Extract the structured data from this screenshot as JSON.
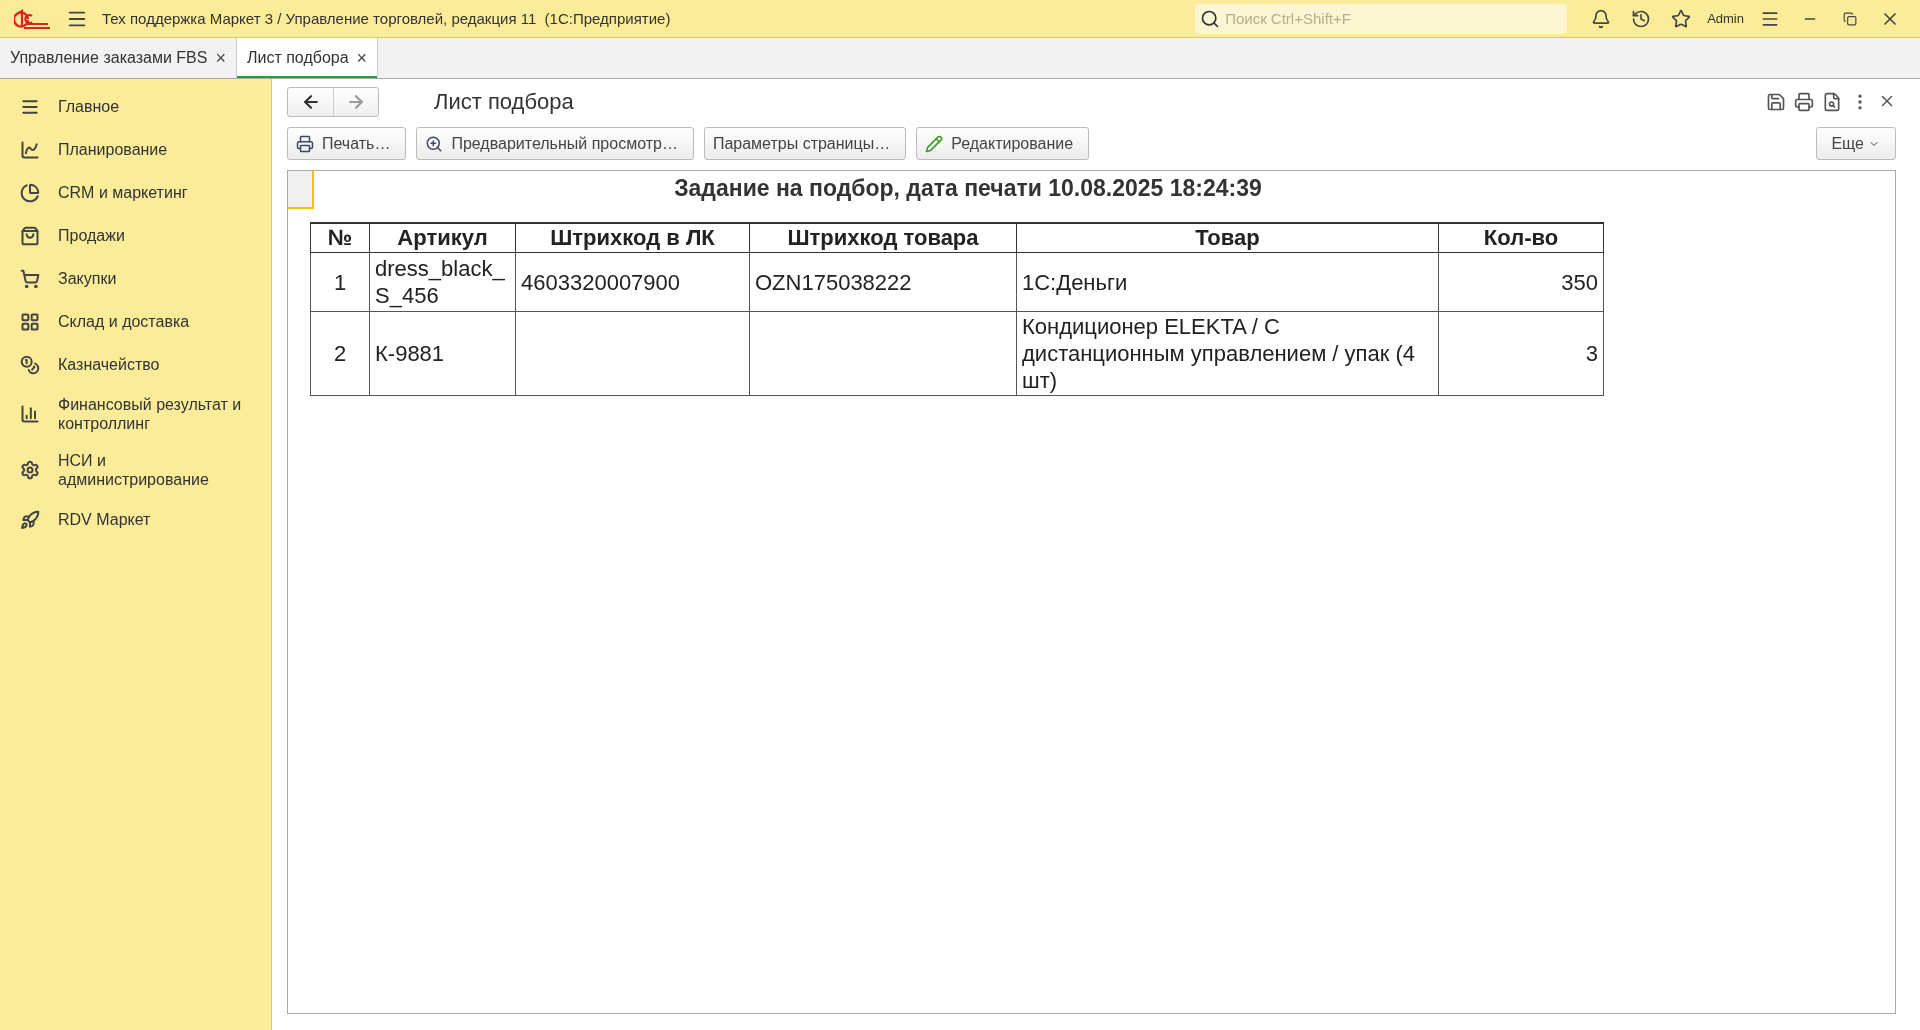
{
  "window": {
    "title": "Тех поддержка Маркет 3 / Управление торговлей, редакция 11  (1С:Предприятие)",
    "search_placeholder": "Поиск Ctrl+Shift+F",
    "user": "Admin"
  },
  "tabs": [
    {
      "label": "Управление заказами FBS",
      "close": "×",
      "selected": false
    },
    {
      "label": "Лист подбора",
      "close": "×",
      "selected": true
    }
  ],
  "sidebar": {
    "items": [
      {
        "label": "Главное"
      },
      {
        "label": "Планирование"
      },
      {
        "label": "CRM и маркетинг"
      },
      {
        "label": "Продажи"
      },
      {
        "label": "Закупки"
      },
      {
        "label": "Склад и доставка"
      },
      {
        "label": "Казначейство"
      },
      {
        "label": "Финансовый результат и контроллинг"
      },
      {
        "label": "НСИ и администрирование"
      },
      {
        "label": "RDV Маркет"
      }
    ]
  },
  "form": {
    "title": "Лист подбора",
    "buttons": [
      {
        "label": "Печать…"
      },
      {
        "label": "Предварительный просмотр…"
      },
      {
        "label": "Параметры страницы…"
      },
      {
        "label": "Редактирование"
      }
    ],
    "more": "Еще"
  },
  "document": {
    "heading": "Задание на подбор, дата печати 10.08.2025 18:24:39",
    "columns": [
      "№",
      "Артикул",
      "Штрихкод в ЛК",
      "Штрихкод товара",
      "Товар",
      "Кол-во"
    ],
    "rows": [
      [
        "1",
        "dress_black_S_456",
        "4603320007900",
        "OZN175038222",
        "1С:Деньги",
        "350"
      ],
      [
        "2",
        "К-9881",
        "",
        "",
        "Кондиционер ELEKTA / С дистанционным управлением / упак (4 шт)",
        "3"
      ]
    ]
  }
}
